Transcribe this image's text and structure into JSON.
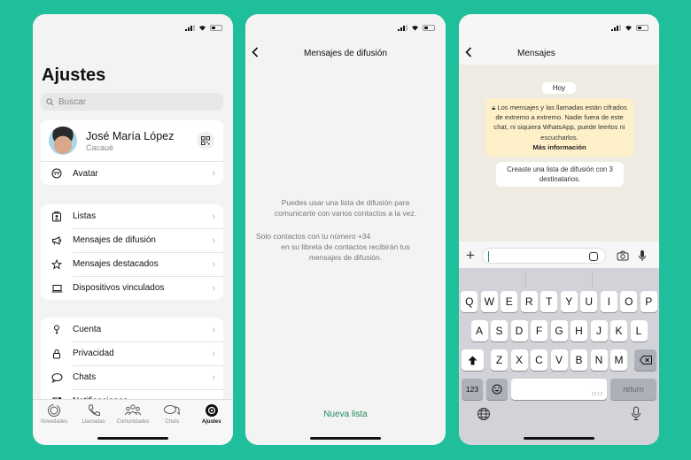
{
  "colors": {
    "background": "#20bf9b",
    "accent_green": "#1f8a5b",
    "encryption_notice": "#fdf0c8"
  },
  "status_bar": {
    "icons": [
      "signal-icon",
      "wifi-icon",
      "battery-icon"
    ]
  },
  "settings": {
    "title": "Ajustes",
    "search_placeholder": "Buscar",
    "profile": {
      "name": "José María López",
      "status": "Cacaué"
    },
    "profile_rows": [
      {
        "icon": "avatar-icon",
        "label": "Avatar"
      }
    ],
    "group1": [
      {
        "icon": "lists-icon",
        "label": "Listas"
      },
      {
        "icon": "megaphone-icon",
        "label": "Mensajes de difusión"
      },
      {
        "icon": "star-icon",
        "label": "Mensajes destacados"
      },
      {
        "icon": "laptop-icon",
        "label": "Dispositivos vinculados"
      }
    ],
    "group2": [
      {
        "icon": "key-icon",
        "label": "Cuenta"
      },
      {
        "icon": "lock-icon",
        "label": "Privacidad"
      },
      {
        "icon": "chat-bubble-icon",
        "label": "Chats"
      },
      {
        "icon": "notification-icon",
        "label": "Notificaciones"
      }
    ],
    "tabs": [
      {
        "icon": "updates-icon",
        "label": "Novedades",
        "active": false
      },
      {
        "icon": "phone-icon",
        "label": "Llamadas",
        "active": false
      },
      {
        "icon": "communities-icon",
        "label": "Comunidades",
        "active": false
      },
      {
        "icon": "chats-icon",
        "label": "Chats",
        "active": false
      },
      {
        "icon": "settings-icon",
        "label": "Ajustes",
        "active": true
      }
    ]
  },
  "broadcast": {
    "title": "Mensajes de difusión",
    "info_line1": "Puedes usar una lista de difusión para",
    "info_line2": "comunicarte con varios contactos a la vez.",
    "notice_line1": "Solo contactos con tu número +34",
    "notice_line2": "en su libreta de contactos recibirán tus",
    "notice_line3": "mensajes de difusión.",
    "new_list": "Nueva lista"
  },
  "chat": {
    "title": "Mensajes",
    "day_label": "Hoy",
    "encryption_text": "Los mensajes y las llamadas están cifrados de extremo a extremo. Nadie fuera de este chat, ni siquiera WhatsApp, puede leerlos ni escucharlos.",
    "encryption_link": "Más información",
    "system_message": "Creaste una lista de difusión con 3 destinatarios.",
    "input_value": ""
  },
  "keyboard": {
    "row1": [
      "Q",
      "W",
      "E",
      "R",
      "T",
      "Y",
      "U",
      "I",
      "O",
      "P"
    ],
    "row2": [
      "A",
      "S",
      "D",
      "F",
      "G",
      "H",
      "J",
      "K",
      "L"
    ],
    "row3": [
      "Z",
      "X",
      "C",
      "V",
      "B",
      "N",
      "M"
    ],
    "numbers_key": "123",
    "return_key": "return",
    "space_hint": "13:13"
  }
}
